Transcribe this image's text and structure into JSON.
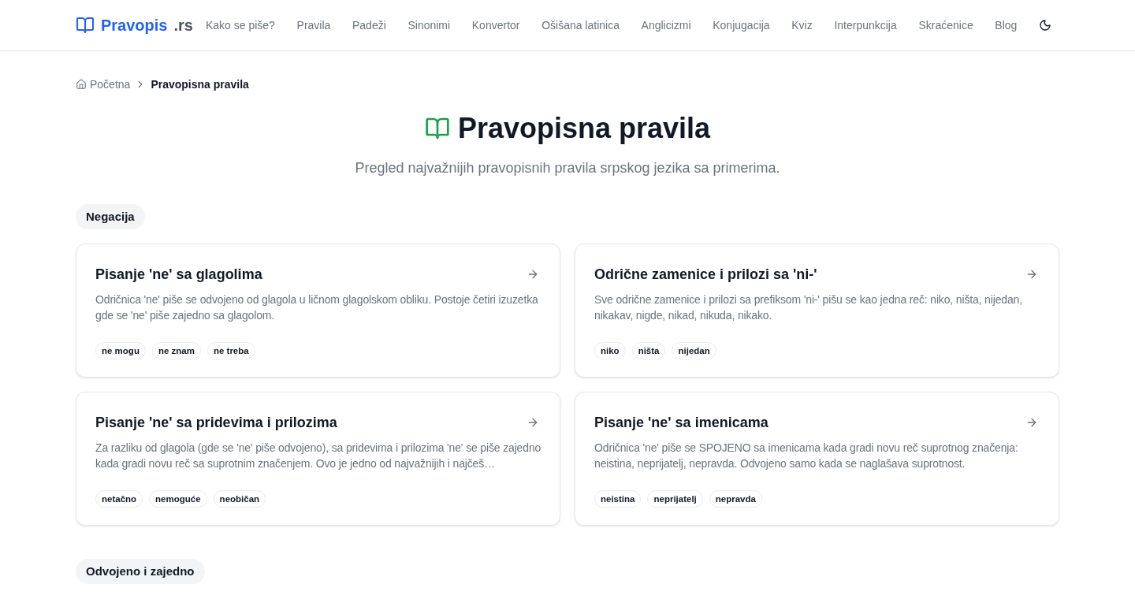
{
  "header": {
    "logo": {
      "name": "Pravopis",
      "suffix": ".rs"
    },
    "nav": [
      "Kako se piše?",
      "Pravila",
      "Padeži",
      "Sinonimi",
      "Konvertor",
      "Ošišana latinica",
      "Anglicizmi",
      "Konjugacija",
      "Kviz",
      "Interpunkcija",
      "Skraćenice",
      "Blog"
    ]
  },
  "breadcrumb": [
    {
      "kind": "home",
      "label": "Početna"
    },
    {
      "kind": "current",
      "label": "Pravopisna pravila"
    }
  ],
  "page": {
    "title": "Pravopisna pravila",
    "subtitle": "Pregled najvažnijih pravopisnih pravila srpskog jezika sa primerima."
  },
  "sections": [
    {
      "title": "Negacija",
      "cards": [
        {
          "title": "Pisanje 'ne' sa glagolima",
          "description": "Odričnica 'ne' piše se odvojeno od glagola u ličnom glagolskom obliku. Postoje četiri izuzetka gde se 'ne' piše zajedno sa glagolom.",
          "tags": [
            "ne mogu",
            "ne znam",
            "ne treba"
          ]
        },
        {
          "title": "Odrične zamenice i prilozi sa 'ni-'",
          "description": "Sve odrične zamenice i prilozi sa prefiksom 'ni-' pišu se kao jedna reč: niko, ništa, nijedan, nikakav, nigde, nikad, nikuda, nikako.",
          "tags": [
            "niko",
            "ništa",
            "nijedan"
          ]
        },
        {
          "title": "Pisanje 'ne' sa pridevima i prilozima",
          "description": "Za razliku od glagola (gde se 'ne' piše odvojeno), sa pridevima i prilozima 'ne' se piše zajedno kada gradi novu reč sa suprotnim značenjem. Ovo je jedno od najvažnijih i najčeš…",
          "tags": [
            "netačno",
            "nemoguće",
            "neobičan"
          ]
        },
        {
          "title": "Pisanje 'ne' sa imenicama",
          "description": "Odričnica 'ne' piše se SPOJENO sa imenicama kada gradi novu reč suprotnog značenja: neistina, neprijatelj, nepravda. Odvojeno samo kada se naglašava suprotnost.",
          "tags": [
            "neistina",
            "neprijatelj",
            "nepravda"
          ]
        }
      ]
    },
    {
      "title": "Odvojeno i zajedno"
    }
  ]
}
